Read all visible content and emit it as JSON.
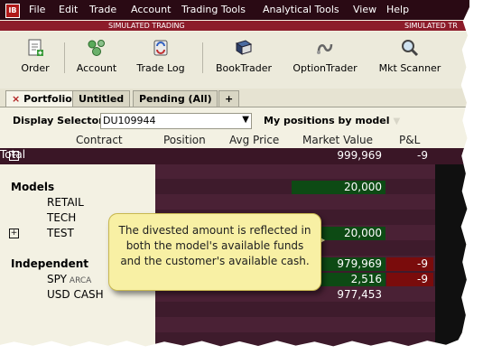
{
  "menu": {
    "logo": "IB",
    "items": [
      "File",
      "Edit",
      "Trade",
      "Account",
      "Trading Tools",
      "Analytical Tools",
      "View",
      "Help"
    ]
  },
  "banner": {
    "left": "SIMULATED TRADING",
    "right": "SIMULATED TR"
  },
  "toolbar": [
    {
      "label": "Order",
      "icon": "order-icon"
    },
    {
      "label": "Account",
      "icon": "account-icon"
    },
    {
      "label": "Trade Log",
      "icon": "trade-log-icon"
    },
    {
      "label": "BookTrader",
      "icon": "booktrader-icon"
    },
    {
      "label": "OptionTrader",
      "icon": "optiontrader-icon"
    },
    {
      "label": "Mkt Scanner",
      "icon": "mkt-scanner-icon"
    }
  ],
  "tabs": {
    "close_glyph": "×",
    "items": [
      "Portfolio",
      "Untitled",
      "Pending (All)",
      "+"
    ]
  },
  "selector": {
    "label": "Display Selector",
    "value": "DU109944",
    "view_label": "My positions by model"
  },
  "columns": [
    "Contract",
    "Position",
    "Avg Price",
    "Market Value",
    "P&L"
  ],
  "rows": {
    "total": {
      "name": "Total",
      "market_value": "999,969",
      "pnl": "-9"
    },
    "models_header": "Models",
    "models_value": "20,000",
    "retail": "RETAIL",
    "tech": "TECH",
    "test": {
      "name": "TEST",
      "market_value": "20,000"
    },
    "independent": {
      "name": "Independent",
      "market_value": "979,969",
      "pnl": "-9"
    },
    "spy": {
      "name": "SPY",
      "exchange": "ARCA",
      "market_value": "2,516",
      "pnl": "-9"
    },
    "usd_cash": {
      "name": "USD CASH",
      "market_value": "977,453"
    }
  },
  "callout": {
    "text": "The divested amount is reflected in both the model's available funds and the customer's available cash."
  },
  "colors": {
    "menubar": "#2a0a14",
    "banner": "#8c1c2a",
    "grid_dark": "#3e1b2c",
    "green_cell": "#0d4a14",
    "red_cell": "#7a0c0c",
    "callout": "#f8f0a4"
  }
}
